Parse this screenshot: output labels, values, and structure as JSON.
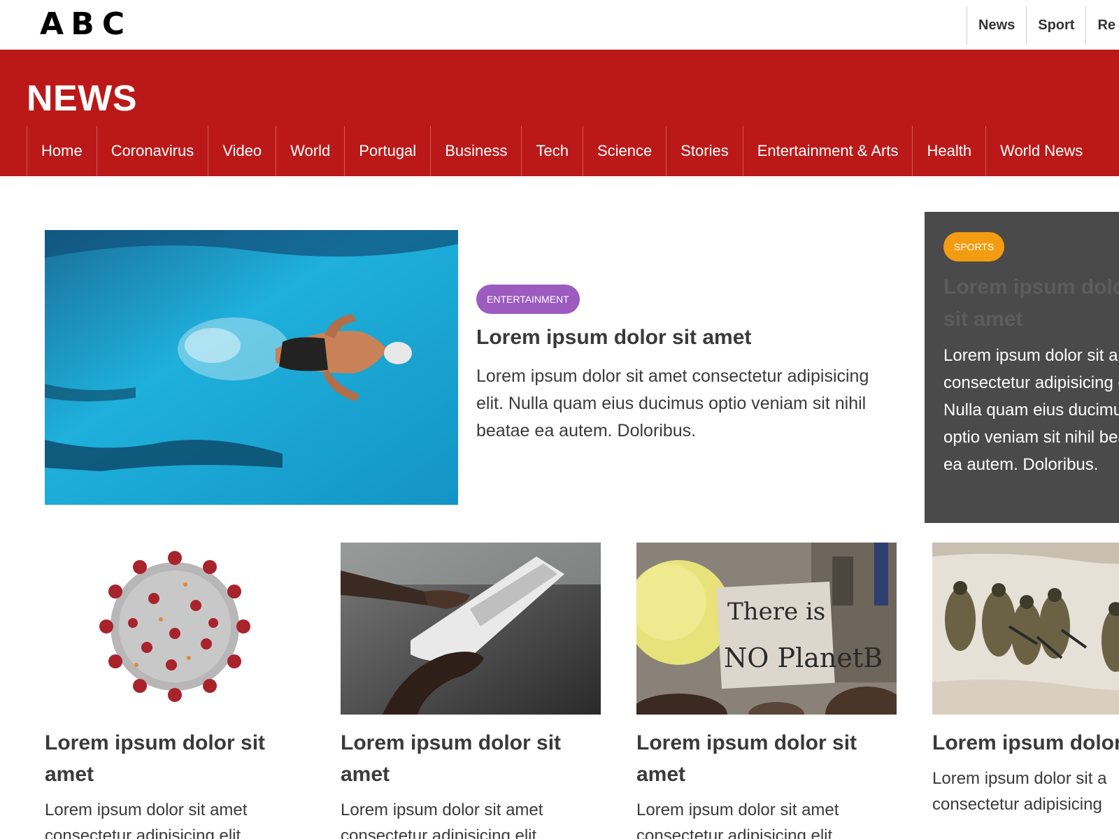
{
  "topbar": {
    "logo_letters": [
      "A",
      "B",
      "C"
    ],
    "nav": [
      "News",
      "Sport",
      "Re"
    ]
  },
  "header": {
    "brand": "NEWS",
    "nav": [
      "Home",
      "Coronavirus",
      "Video",
      "World",
      "Portugal",
      "Business",
      "Tech",
      "Science",
      "Stories",
      "Entertainment & Arts",
      "Health",
      "World News"
    ]
  },
  "featured": {
    "image_icon": "swimmer-photo",
    "category": "ENTERTAINMENT",
    "title": "Lorem ipsum dolor sit amet",
    "text": "Lorem ipsum dolor sit amet consectetur adipisicing elit. Nulla quam eius ducimus optio veniam sit nihil beatae ea autem. Doloribus."
  },
  "side": {
    "category": "SPORTS",
    "title": "Lorem ipsum dolor sit amet",
    "text": "Lorem ipsum dolor sit amet consectetur adipisicing elit. Nulla quam eius ducimus optio veniam sit nihil beatae ea autem. Doloribus."
  },
  "cards": [
    {
      "image_icon": "coronavirus-photo",
      "title": "Lorem ipsum dolor sit amet",
      "text": "Lorem ipsum dolor sit amet consectetur adipisicing elit"
    },
    {
      "image_icon": "newspaper-photo",
      "title": "Lorem ipsum dolor sit amet",
      "text": "Lorem ipsum dolor sit amet consectetur adipisicing elit"
    },
    {
      "image_icon": "protest-sign-photo",
      "title": "Lorem ipsum dolor sit amet",
      "text": "Lorem ipsum dolor sit amet consectetur adipisicing elit"
    },
    {
      "image_icon": "soldiers-photo",
      "title": "Lorem ipsum dolor sit amet",
      "text": "Lorem ipsum dolor sit a consectetur adipisicing"
    }
  ],
  "protest_sign_text": [
    "There is",
    "NO PlanetB"
  ],
  "colors": {
    "brand_red": "#bb1919",
    "entertainment": "#9c5bbf",
    "sports": "#f39c12",
    "side_card_bg": "#4a4a4a"
  }
}
